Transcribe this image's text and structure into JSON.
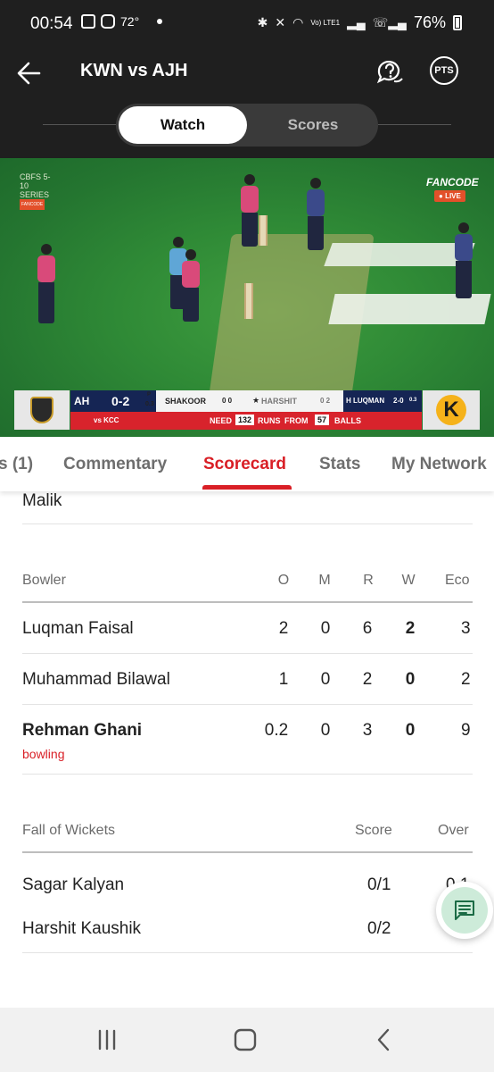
{
  "status_bar": {
    "time": "00:54",
    "temp": "72°",
    "network": "Vo) LTE1",
    "battery": "76%"
  },
  "header": {
    "title": "KWN vs AJH",
    "pts_label": "PTS"
  },
  "toggle": {
    "watch": "Watch",
    "scores": "Scores"
  },
  "video": {
    "series_logo": "CBFS 5-10 SERIES",
    "small_logo": "FANCODE",
    "brand": "FANCODE",
    "live": "LIVE",
    "scorebug": {
      "team": "AH",
      "score": "0-2",
      "overs": "0.3",
      "overs_prefix": "P",
      "batter1": "SHAKOOR",
      "batter1_score": "0 0",
      "batter2": "HARSHIT",
      "batter2_score": "0 2",
      "bowler": "H LUQMAN",
      "bowler_fig": "2-0",
      "bowler_overs": "0.3",
      "vs": "vs KCC",
      "need_label": "NEED",
      "runs_needed": "132",
      "runs_label": "RUNS",
      "from_label": "FROM",
      "balls": "57",
      "balls_label": "BALLS",
      "team_logo": "K"
    }
  },
  "tabs": [
    {
      "label": "s (1)"
    },
    {
      "label": "Commentary"
    },
    {
      "label": "Scorecard"
    },
    {
      "label": "Stats"
    },
    {
      "label": "My Network"
    }
  ],
  "scorecard": {
    "prev_batter": "Malik",
    "bowler_headers": {
      "name": "Bowler",
      "o": "O",
      "m": "M",
      "r": "R",
      "w": "W",
      "eco": "Eco"
    },
    "bowlers": [
      {
        "name": "Luqman Faisal",
        "o": "2",
        "m": "0",
        "r": "6",
        "w": "2",
        "eco": "3"
      },
      {
        "name": "Muhammad Bilawal",
        "o": "1",
        "m": "0",
        "r": "2",
        "w": "0",
        "eco": "2"
      },
      {
        "name": "Rehman Ghani",
        "status": "bowling",
        "o": "0.2",
        "m": "0",
        "r": "3",
        "w": "0",
        "eco": "9"
      }
    ],
    "fow_headers": {
      "name": "Fall of Wickets",
      "score": "Score",
      "over": "Over"
    },
    "fow": [
      {
        "name": "Sagar Kalyan",
        "score": "0/1",
        "over": "0.1"
      },
      {
        "name": "Harshit Kaushik",
        "score": "0/2",
        "over": "0.2"
      }
    ]
  },
  "icons": {
    "back": "arrow-left-icon",
    "help": "question-chat-icon",
    "chat": "chat-icon",
    "nav_recent": "recents-icon",
    "nav_home": "home-icon",
    "nav_back": "back-chevron-icon"
  },
  "colors": {
    "accent": "#d91f26",
    "header_bg": "#1f1f1f",
    "chat_bg": "#cdebd9"
  }
}
